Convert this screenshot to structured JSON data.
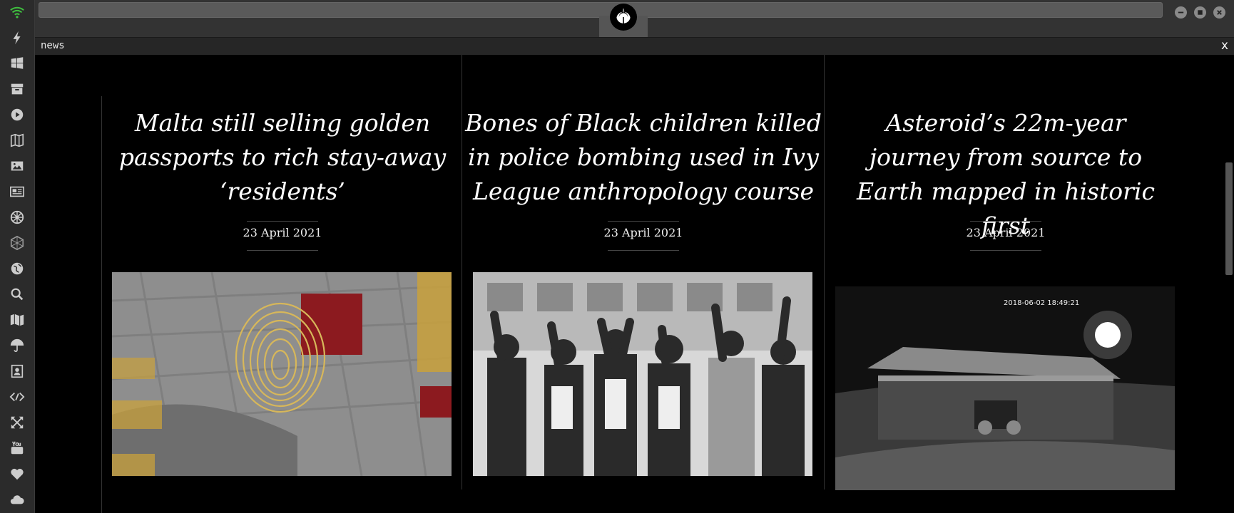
{
  "section": {
    "title": "news",
    "close": "x"
  },
  "sidebar": {
    "items": [
      {
        "icon": "wifi-icon"
      },
      {
        "icon": "lightning-icon"
      },
      {
        "icon": "windows-icon"
      },
      {
        "icon": "archive-icon"
      },
      {
        "icon": "play-icon"
      },
      {
        "icon": "map-book-icon"
      },
      {
        "icon": "image-icon"
      },
      {
        "icon": "newspaper-icon"
      },
      {
        "icon": "empire-icon"
      },
      {
        "icon": "hexagon-icon"
      },
      {
        "icon": "globe-icon"
      },
      {
        "icon": "search-icon"
      },
      {
        "icon": "map-icon"
      },
      {
        "icon": "umbrella-icon"
      },
      {
        "icon": "contacts-icon"
      },
      {
        "icon": "code-icon"
      },
      {
        "icon": "expand-icon"
      },
      {
        "icon": "youtube-icon"
      },
      {
        "icon": "heart-icon"
      },
      {
        "icon": "cloud-icon"
      }
    ]
  },
  "colors": {
    "accent": "#3fbf3f",
    "background": "#000000",
    "sidebar": "#2b2b2b"
  },
  "articles": [
    {
      "title": "Malta still selling golden passports to rich stay-away ‘residents’",
      "date": "23 April 2021",
      "image": "fingerprint-collage"
    },
    {
      "title": "Bones of Black children killed in police bombing used in Ivy League anthropology course",
      "date": "23 April 2021",
      "image": "protest-photo"
    },
    {
      "title": "Asteroid’s 22m-year journey from source to Earth mapped in historic first",
      "date": "23 April 2021",
      "image": "night-camera-photo",
      "image_timestamp": "2018-06-02 18:49:21"
    }
  ]
}
